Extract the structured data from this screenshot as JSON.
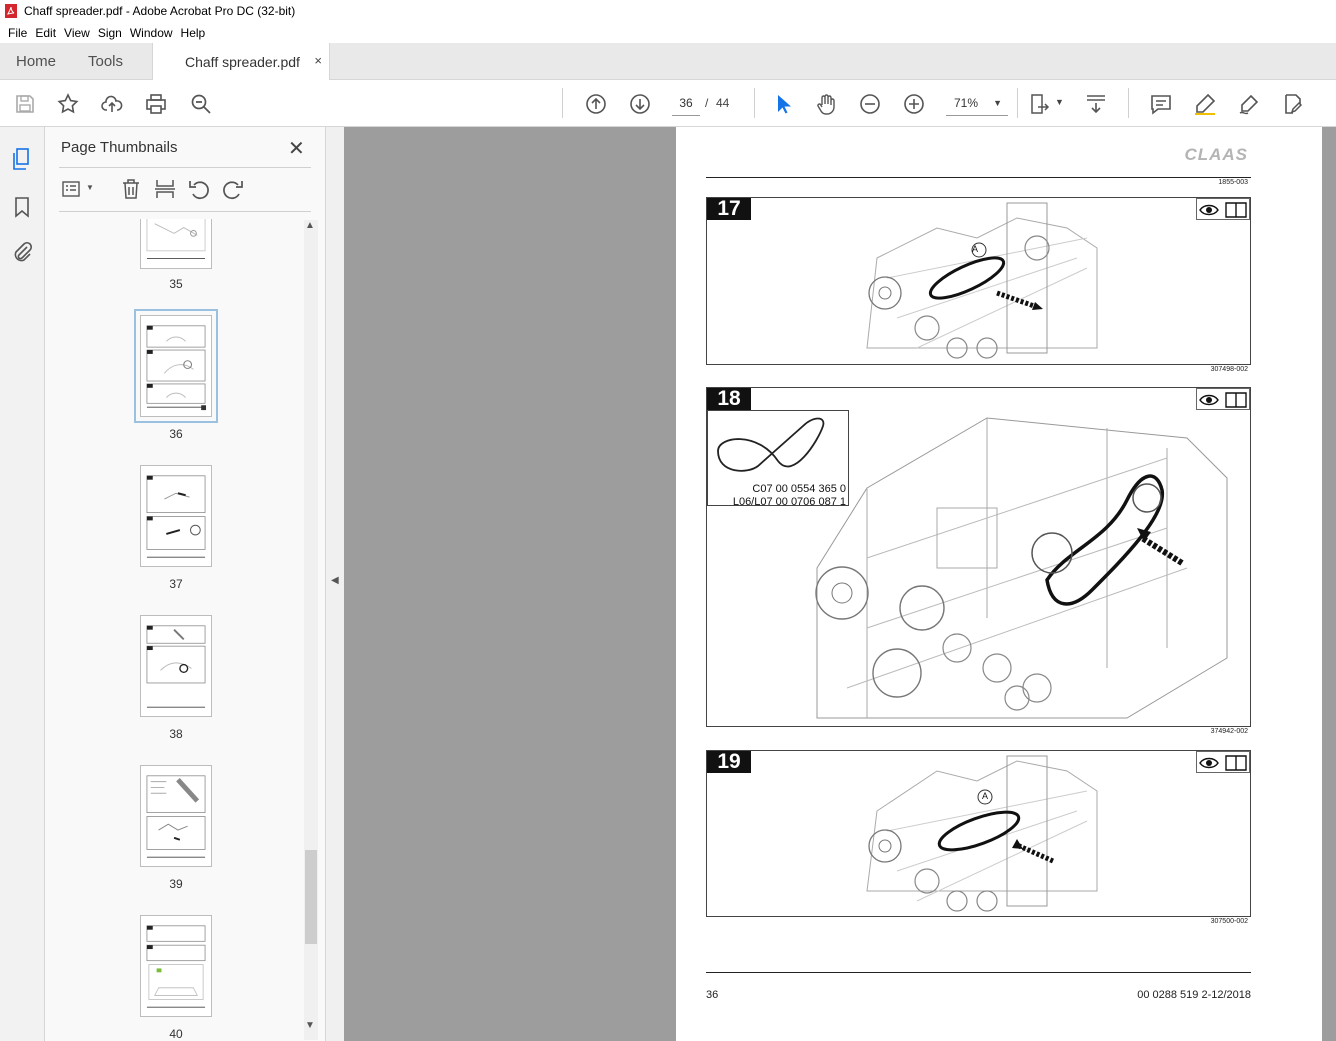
{
  "window": {
    "title": "Chaff spreader.pdf - Adobe Acrobat Pro DC (32-bit)"
  },
  "menu": [
    "File",
    "Edit",
    "View",
    "Sign",
    "Window",
    "Help"
  ],
  "tabs": {
    "home": "Home",
    "tools": "Tools",
    "document": "Chaff spreader.pdf",
    "close": "×"
  },
  "toolbar": {
    "current_page": "36",
    "separator": "/",
    "total_pages": "44",
    "zoom": "71%"
  },
  "panel": {
    "title": "Page Thumbnails",
    "close": "✕",
    "thumbnails": [
      {
        "number": "35"
      },
      {
        "number": "36",
        "selected": true
      },
      {
        "number": "37"
      },
      {
        "number": "38"
      },
      {
        "number": "39"
      },
      {
        "number": "40"
      }
    ]
  },
  "page": {
    "logo": "CLAAS",
    "header_docno": "1855-003",
    "figures": [
      {
        "number": "17",
        "ref": "307498-002",
        "callout": "A"
      },
      {
        "number": "18",
        "ref": "374942-002",
        "part1": "C07 00 0554 365 0",
        "part2": "L06/L07 00 0706 087 1"
      },
      {
        "number": "19",
        "ref": "307500-002",
        "callout": "A"
      }
    ],
    "footer_page": "36",
    "footer_doc": "00 0288 519 2-12/2018"
  },
  "colors": {
    "accent": "#1473e6",
    "viewer_bg": "#9d9d9d",
    "pdf_icon": "#d4262d"
  }
}
